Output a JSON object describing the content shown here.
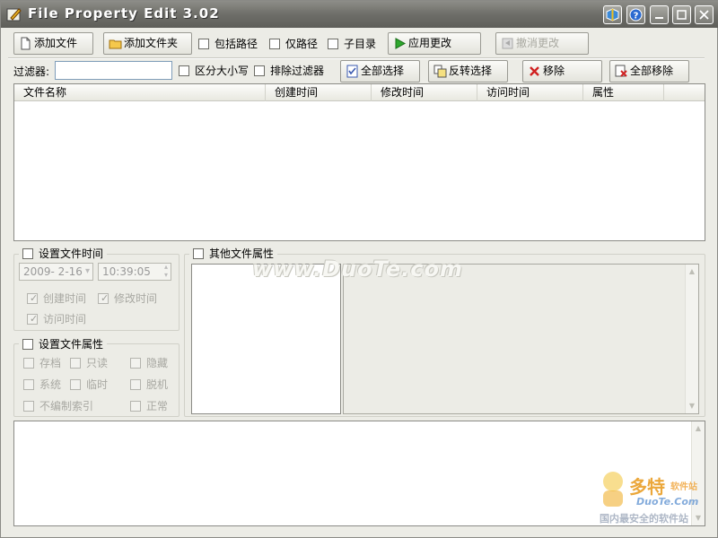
{
  "window": {
    "title": "File Property Edit  3.02"
  },
  "toolbar": {
    "add_file": "添加文件",
    "add_folder": "添加文件夹",
    "include_path": "包括路径",
    "path_only": "仅路径",
    "subdirectory": "子目录",
    "apply_changes": "应用更改",
    "undo_changes": "撤消更改"
  },
  "filter": {
    "label": "过滤器:",
    "value": "",
    "case_sensitive": "区分大小写",
    "exclude_filter": "排除过滤器",
    "select_all": "全部选择",
    "invert_selection": "反转选择",
    "remove": "移除",
    "remove_all": "全部移除"
  },
  "file_list": {
    "columns": [
      "文件名称",
      "创建时间",
      "修改时间",
      "访问时间",
      "属性"
    ],
    "rows": []
  },
  "set_time": {
    "title": "设置文件时间",
    "date_value": "2009- 2-16",
    "time_value": "10:39:05",
    "created_time": "创建时间",
    "modified_time": "修改时间",
    "accessed_time": "访问时间"
  },
  "set_attributes": {
    "title": "设置文件属性",
    "archive": "存档",
    "read_only": "只读",
    "hidden": "隐藏",
    "system": "系统",
    "temporary": "临时",
    "offline": "脱机",
    "not_indexed": "不编制索引",
    "normal": "正常"
  },
  "other_properties": {
    "title": "其他文件属性"
  },
  "watermark": {
    "text": "www.DuoTe.com"
  },
  "logo": {
    "brand": "多特",
    "subtitle": "软件站",
    "domain": "DuoTe.Com",
    "slogan": "国内最安全的软件站"
  },
  "colors": {
    "titlebar": "#6e6e69",
    "accent_green": "#2ea82e",
    "remove_red": "#d02020",
    "logo_orange": "#f0a020"
  }
}
